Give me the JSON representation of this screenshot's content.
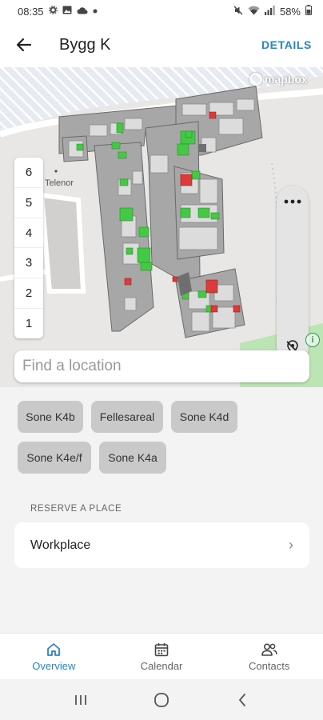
{
  "status_bar": {
    "time": "08:35",
    "battery": "58%",
    "left_icons": [
      "gear-icon",
      "image-icon",
      "cloud-icon",
      "dot-icon"
    ],
    "right_icons": [
      "mute-icon",
      "wifi-icon",
      "signal-icon",
      "battery-icon"
    ]
  },
  "app_bar": {
    "title": "Bygg K",
    "details_label": "DETAILS",
    "back_icon": "arrow-left-icon"
  },
  "map": {
    "attribution": "mapbox",
    "place_label": "Telenor",
    "floors": [
      "6",
      "5",
      "4",
      "3",
      "2",
      "1"
    ],
    "more_icon": "more-horizontal-icon",
    "locate_icon": "location-off-icon",
    "info_label": "i",
    "colors": {
      "available": "#45c845",
      "occupied": "#dc3b3b",
      "room": "#dcdcdc",
      "building": "#a7a7a7",
      "park": "#bde4b4"
    }
  },
  "search": {
    "placeholder": "Find a location"
  },
  "zones": [
    "Sone K4b",
    "Fellesareal",
    "Sone K4d",
    "Sone K4e/f",
    "Sone K4a"
  ],
  "reserve": {
    "header": "RESERVE A PLACE",
    "items": [
      {
        "label": "Workplace",
        "chevron": "›"
      }
    ]
  },
  "bottom_nav": {
    "items": [
      {
        "label": "Overview",
        "icon": "home-icon",
        "active": true
      },
      {
        "label": "Calendar",
        "icon": "calendar-icon",
        "active": false
      },
      {
        "label": "Contacts",
        "icon": "people-icon",
        "active": false
      }
    ],
    "accent": "#2b86c5"
  },
  "system_nav": {
    "buttons": [
      "recents-icon",
      "home-circle-icon",
      "back-chevron-icon"
    ]
  }
}
